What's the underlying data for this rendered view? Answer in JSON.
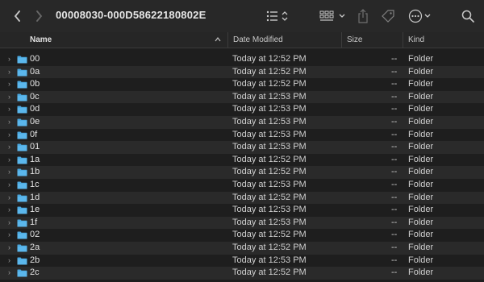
{
  "window": {
    "title": "00008030-000D58622180802E"
  },
  "colors": {
    "folder": "#4aa8e0",
    "background": "#1e1e1e",
    "alt_row": "#2a2a2a"
  },
  "columns": {
    "name": "Name",
    "date_modified": "Date Modified",
    "size": "Size",
    "kind": "Kind"
  },
  "rows": [
    {
      "name": "00",
      "date": "Today at 12:52 PM",
      "size": "--",
      "kind": "Folder"
    },
    {
      "name": "0a",
      "date": "Today at 12:52 PM",
      "size": "--",
      "kind": "Folder"
    },
    {
      "name": "0b",
      "date": "Today at 12:52 PM",
      "size": "--",
      "kind": "Folder"
    },
    {
      "name": "0c",
      "date": "Today at 12:53 PM",
      "size": "--",
      "kind": "Folder"
    },
    {
      "name": "0d",
      "date": "Today at 12:53 PM",
      "size": "--",
      "kind": "Folder"
    },
    {
      "name": "0e",
      "date": "Today at 12:53 PM",
      "size": "--",
      "kind": "Folder"
    },
    {
      "name": "0f",
      "date": "Today at 12:53 PM",
      "size": "--",
      "kind": "Folder"
    },
    {
      "name": "01",
      "date": "Today at 12:53 PM",
      "size": "--",
      "kind": "Folder"
    },
    {
      "name": "1a",
      "date": "Today at 12:52 PM",
      "size": "--",
      "kind": "Folder"
    },
    {
      "name": "1b",
      "date": "Today at 12:52 PM",
      "size": "--",
      "kind": "Folder"
    },
    {
      "name": "1c",
      "date": "Today at 12:53 PM",
      "size": "--",
      "kind": "Folder"
    },
    {
      "name": "1d",
      "date": "Today at 12:52 PM",
      "size": "--",
      "kind": "Folder"
    },
    {
      "name": "1e",
      "date": "Today at 12:53 PM",
      "size": "--",
      "kind": "Folder"
    },
    {
      "name": "1f",
      "date": "Today at 12:53 PM",
      "size": "--",
      "kind": "Folder"
    },
    {
      "name": "02",
      "date": "Today at 12:52 PM",
      "size": "--",
      "kind": "Folder"
    },
    {
      "name": "2a",
      "date": "Today at 12:52 PM",
      "size": "--",
      "kind": "Folder"
    },
    {
      "name": "2b",
      "date": "Today at 12:53 PM",
      "size": "--",
      "kind": "Folder"
    },
    {
      "name": "2c",
      "date": "Today at 12:52 PM",
      "size": "--",
      "kind": "Folder"
    }
  ]
}
